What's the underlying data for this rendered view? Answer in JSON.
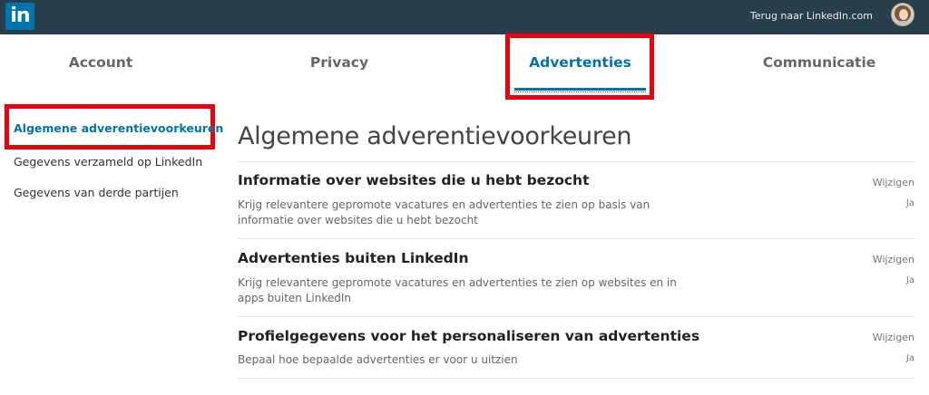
{
  "topbar": {
    "logo_text": "in",
    "back_link": "Terug naar LinkedIn.com"
  },
  "tabs": [
    {
      "label": "Account"
    },
    {
      "label": "Privacy"
    },
    {
      "label": "Advertenties",
      "active": true
    },
    {
      "label": "Communicatie"
    }
  ],
  "sidebar": {
    "items": [
      {
        "label": "Algemene adverentievoorkeuren",
        "active": true
      },
      {
        "label": "Gegevens verzameld op LinkedIn"
      },
      {
        "label": "Gegevens van derde partijen"
      }
    ]
  },
  "main": {
    "title": "Algemene adverentievoorkeuren",
    "sections": [
      {
        "title": "Informatie over websites die u hebt bezocht",
        "description": "Krijg relevantere gepromote vacatures en advertenties te zien op basis van informatie over websites die u hebt bezocht",
        "edit_label": "Wijzigen",
        "value": "Ja"
      },
      {
        "title": "Advertenties buiten LinkedIn",
        "description": "Krijg relevantere gepromote vacatures en advertenties te zien op websites en in apps buiten LinkedIn",
        "edit_label": "Wijzigen",
        "value": "Ja"
      },
      {
        "title": "Profielgegevens voor het personaliseren van advertenties",
        "description": "Bepaal hoe bepaalde advertenties er voor u uitzien",
        "edit_label": "Wijzigen",
        "value": "Ja"
      }
    ]
  },
  "colors": {
    "topbar": "#283e4a",
    "brand": "#0073b1",
    "highlight": "#e8020e"
  }
}
